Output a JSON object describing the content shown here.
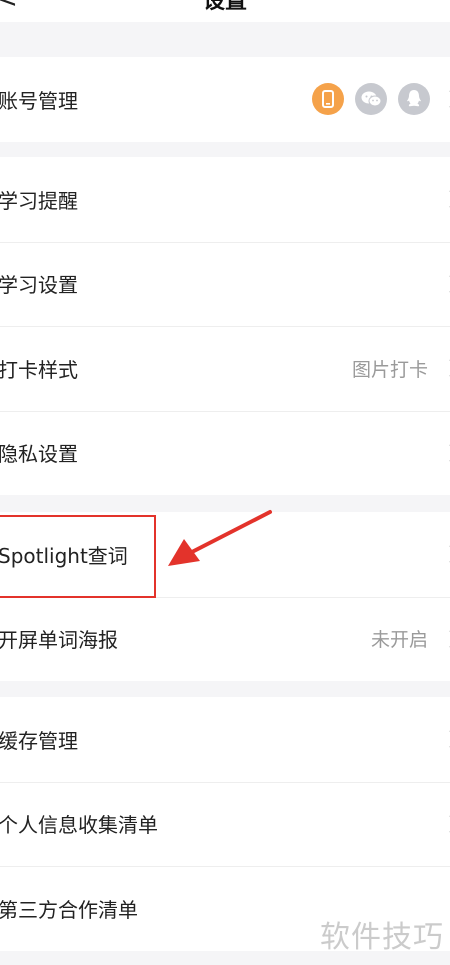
{
  "header": {
    "back_glyph": "<",
    "title": "设置"
  },
  "groups": [
    {
      "rows": [
        {
          "label": "账号管理",
          "accounts": [
            "phone-icon",
            "wechat-icon",
            "qq-icon"
          ]
        }
      ]
    },
    {
      "rows": [
        {
          "label": "学习提醒"
        },
        {
          "label": "学习设置"
        },
        {
          "label": "打卡样式",
          "value": "图片打卡"
        },
        {
          "label": "隐私设置"
        }
      ]
    },
    {
      "rows": [
        {
          "label": "Spotlight查词"
        },
        {
          "label": "开屏单词海报",
          "value": "未开启"
        }
      ]
    },
    {
      "rows": [
        {
          "label": "缓存管理"
        },
        {
          "label": "个人信息收集清单"
        },
        {
          "label": "第三方合作清单"
        }
      ]
    }
  ],
  "annotation": {
    "color": "#e3332b"
  },
  "colors": {
    "account_active": "#f5a24a",
    "account_inactive": "#c7c9cf"
  },
  "watermark": "软件技巧"
}
